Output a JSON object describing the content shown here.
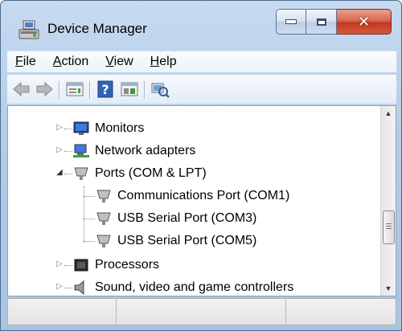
{
  "window": {
    "title": "Device Manager"
  },
  "menu": [
    {
      "label_ul": "F",
      "label_rest": "ile"
    },
    {
      "label_ul": "A",
      "label_rest": "ction"
    },
    {
      "label_ul": "V",
      "label_rest": "iew"
    },
    {
      "label_ul": "H",
      "label_rest": "elp"
    }
  ],
  "toolbar": {
    "icons": [
      "back-arrow-icon",
      "forward-arrow-icon",
      "properties-icon",
      "help-icon",
      "update-driver-icon",
      "scan-hardware-icon"
    ]
  },
  "tree": {
    "items": [
      {
        "label": "Monitors",
        "icon": "monitor-icon",
        "level": 0,
        "expanded": false
      },
      {
        "label": "Network adapters",
        "icon": "network-adapter-icon",
        "level": 0,
        "expanded": false
      },
      {
        "label": "Ports (COM & LPT)",
        "icon": "port-icon",
        "level": 0,
        "expanded": true
      },
      {
        "label": "Communications Port (COM1)",
        "icon": "port-icon",
        "level": 1
      },
      {
        "label": "USB Serial Port (COM3)",
        "icon": "port-icon",
        "level": 1
      },
      {
        "label": "USB Serial Port (COM5)",
        "icon": "port-icon",
        "level": 1
      },
      {
        "label": "Processors",
        "icon": "processor-icon",
        "level": 0,
        "expanded": false
      },
      {
        "label": "Sound, video and game controllers",
        "icon": "speaker-icon",
        "level": 0,
        "expanded": false
      }
    ]
  },
  "colors": {
    "titlebar": "#b9cfea",
    "close": "#c7432a",
    "tree_bg": "#ffffff"
  }
}
